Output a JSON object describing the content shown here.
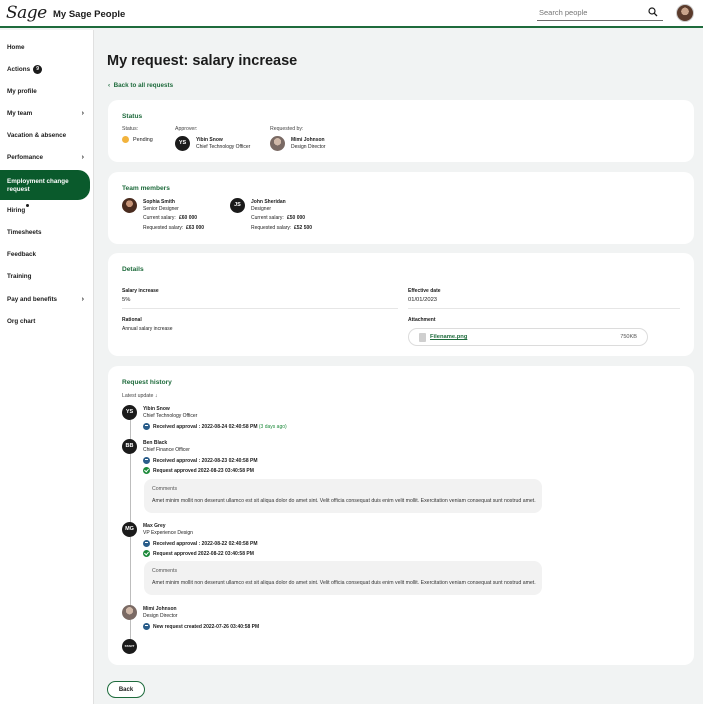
{
  "header": {
    "logo": "Sage",
    "app_title": "My Sage People",
    "search_placeholder": "Search people"
  },
  "sidebar": {
    "items": [
      {
        "label": "Home"
      },
      {
        "label": "Actions",
        "badge": "9"
      },
      {
        "label": "My profile"
      },
      {
        "label": "My team"
      },
      {
        "label": "Vacation & absence"
      },
      {
        "label": "Perfomance"
      },
      {
        "label": "Employment change request"
      },
      {
        "label": "Hiring"
      },
      {
        "label": "Timesheets"
      },
      {
        "label": "Feedback"
      },
      {
        "label": "Training"
      },
      {
        "label": "Pay and benefits"
      },
      {
        "label": "Org chart"
      }
    ]
  },
  "main": {
    "title": "My request: salary increase",
    "back_link": "Back to all requests",
    "status_card": {
      "title": "Status",
      "status_label": "Status:",
      "status_value": "Pending",
      "approver_label": "Approver:",
      "approver_initials": "YS",
      "approver_name": "Yibin Snow",
      "approver_role": "Chief Technology Officer",
      "requested_label": "Requested by:",
      "requester_name": "Mimi Johnson",
      "requester_role": "Design Director"
    },
    "team_card": {
      "title": "Team members",
      "members": [
        {
          "name": "Sophia Smith",
          "role": "Senior Designer",
          "current_label": "Current salary:",
          "current": "£60 000",
          "requested_label": "Requested salary:",
          "requested": "£63 000"
        },
        {
          "initials": "JS",
          "name": "John Sheridan",
          "role": "Designer",
          "current_label": "Current salary:",
          "current": "£50 000",
          "requested_label": "Requested salary:",
          "requested": "£52 500"
        }
      ]
    },
    "details_card": {
      "title": "Details",
      "salary_increase_label": "Salary increase",
      "salary_increase_value": "5%",
      "effective_date_label": "Effective date",
      "effective_date_value": "01/01/2023",
      "rational_label": "Rational",
      "rational_value": "Annual salary increase",
      "attachment_label": "Attachment",
      "file_name": "Filename.png",
      "file_size": "750KB"
    },
    "history_card": {
      "title": "Request history",
      "sort_label": "Latest update ↓",
      "entries": [
        {
          "initials": "YS",
          "name": "Yibin Snow",
          "role": "Chief Technology Officer",
          "event1": "Received approval : 2022-08-24 02:40:58 PM",
          "ago": "(3 days ago)"
        },
        {
          "initials": "BB",
          "name": "Ben Black",
          "role": "Chief Finance Officer",
          "event1": "Received approval : 2022-08-23 02:40:58 PM",
          "event2": "Request approved 2022-08-23 03:40:58 PM",
          "comment_title": "Comments",
          "comment_text": "Amet minim mollit non deserunt ullamco est sit aliqua dolor do amet sint. Velit officia consequat duis enim velit mollit. Exercitation veniam consequat sunt nostrud amet."
        },
        {
          "initials": "MG",
          "name": "Max Grey",
          "role": "VP Experience Design",
          "event1": "Received approval : 2022-08-22 02:40:58 PM",
          "event2": "Request approved 2022-08-22 03:40:58 PM",
          "comment_title": "Comments",
          "comment_text": "Amet minim mollit non deserunt ullamco est sit aliqua dolor do amet sint. Velit officia consequat duis enim velit mollit. Exercitation veniam consequat sunt nostrud amet."
        },
        {
          "name": "Mimi Johnson",
          "role": "Design Director",
          "event1": "New request created 2022-07-26 03:40:58 PM"
        },
        {
          "initials": "START"
        }
      ]
    },
    "back_button": "Back"
  }
}
